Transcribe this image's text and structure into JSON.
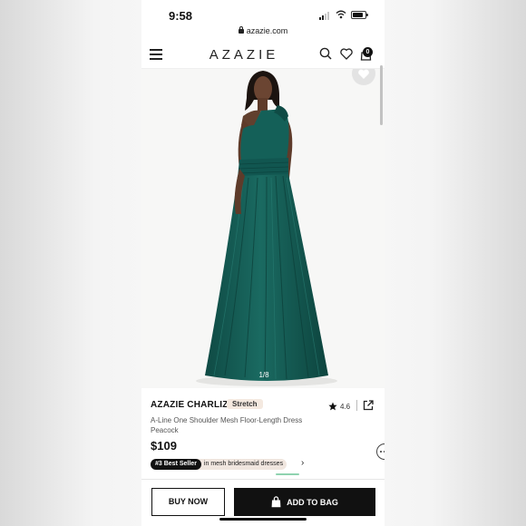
{
  "status_bar": {
    "time": "9:58"
  },
  "browser": {
    "url": "azazie.com"
  },
  "header": {
    "brand": "AZAZIE",
    "cart_count": "0"
  },
  "gallery": {
    "counter": "1/8"
  },
  "product": {
    "name": "AZAZIE CHARLIZE",
    "badge": "Stretch",
    "rating": "4.6",
    "description_line1": "A-Line One Shoulder Mesh Floor-Length Dress",
    "description_line2": "Peacock",
    "price": "$109",
    "bestseller_tag": "#3 Best Seller",
    "bestseller_text": "in mesh bridesmaid dresses"
  },
  "actions": {
    "buy_now": "BUY NOW",
    "add_to_bag": "ADD TO BAG"
  },
  "colors": {
    "dress": "#13564f",
    "accent": "#111111",
    "badge_bg": "#f4e9e0"
  },
  "icons": [
    "menu-icon",
    "search-icon",
    "heart-icon",
    "bag-icon",
    "star-icon",
    "share-icon",
    "chat-icon"
  ]
}
